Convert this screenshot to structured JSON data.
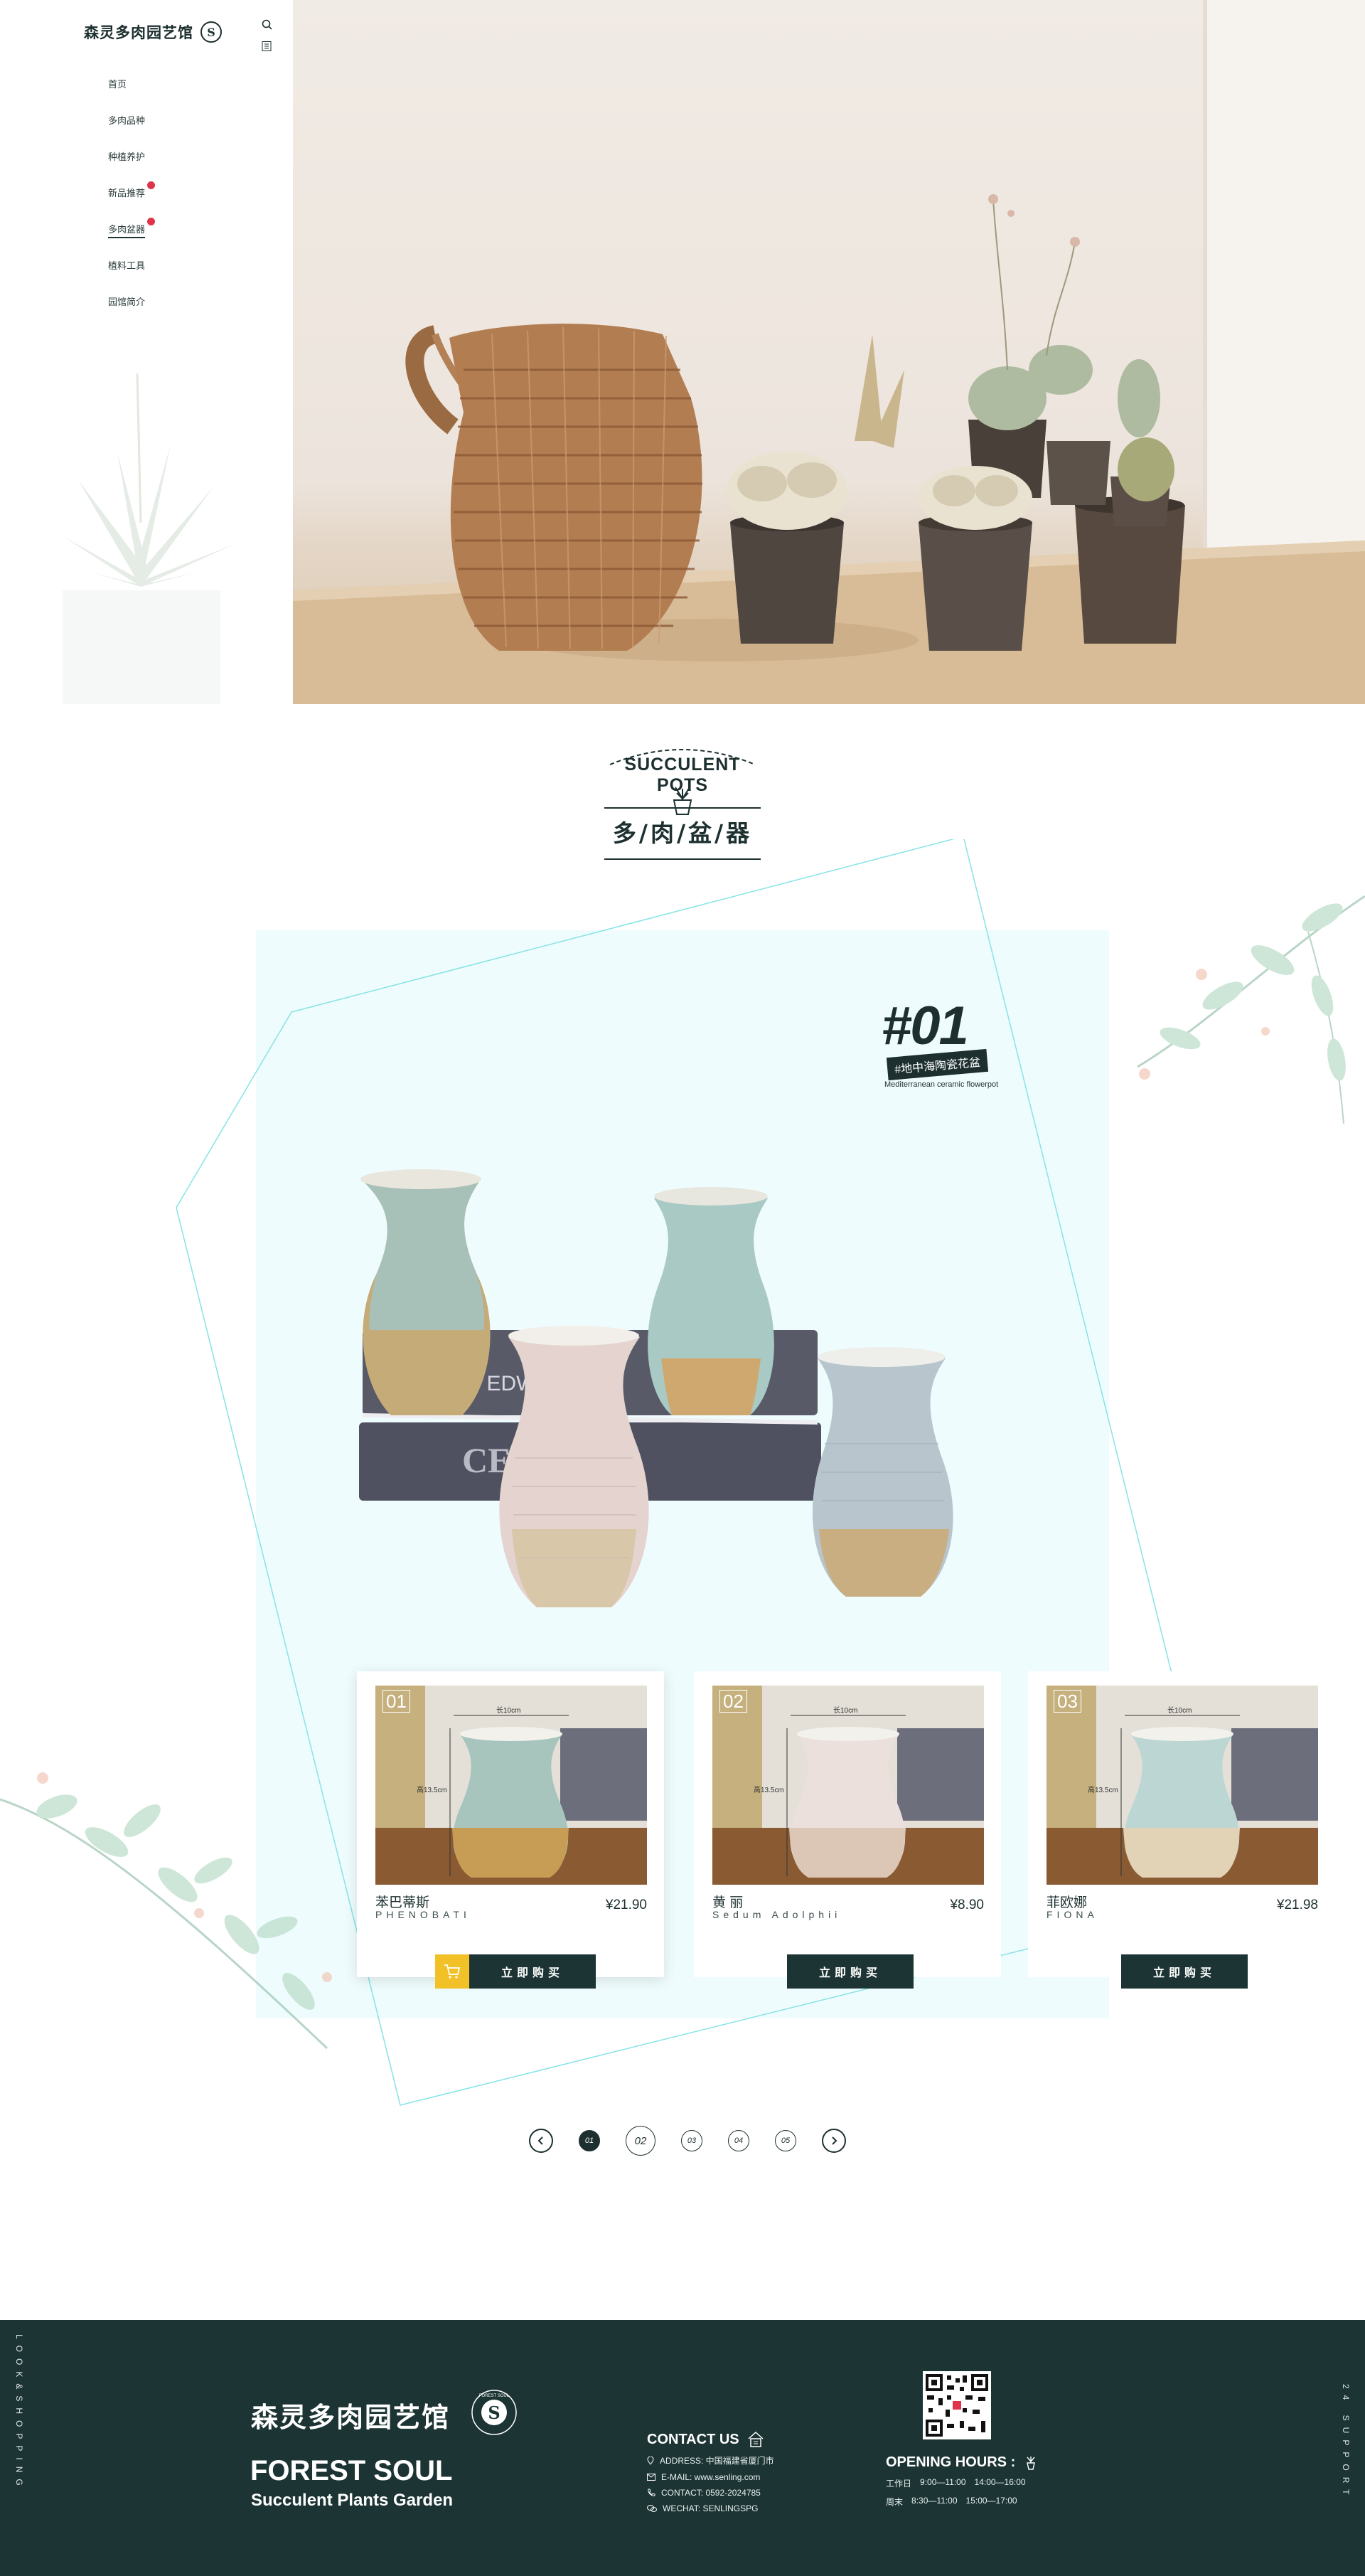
{
  "brand": {
    "name_cn": "森灵多肉园艺馆",
    "badge_letter": "S"
  },
  "nav": {
    "items": [
      {
        "label": "首页",
        "hot": false,
        "active": false
      },
      {
        "label": "多肉品种",
        "hot": false,
        "active": false
      },
      {
        "label": "种植养护",
        "hot": false,
        "active": false
      },
      {
        "label": "新品推荐",
        "hot": true,
        "active": false
      },
      {
        "label": "多肉盆器",
        "hot": true,
        "active": true
      },
      {
        "label": "植料工具",
        "hot": false,
        "active": false
      },
      {
        "label": "园馆简介",
        "hot": false,
        "active": false
      }
    ]
  },
  "section": {
    "title_en": "SUCCULENT POTS",
    "title_cn": "多/肉/盆/器"
  },
  "feature": {
    "number": "#01",
    "tag_cn": "#地中海陶瓷花盆",
    "tag_en": "Mediterranean ceramic flowerpot"
  },
  "products": [
    {
      "num": "01",
      "name": "苯巴蒂斯",
      "sub": "PHENOBATI",
      "price": "¥21.90",
      "buy_label": "立即购买",
      "dims_w": "长10cm",
      "dims_h": "高13.5cm",
      "glaze": "amber"
    },
    {
      "num": "02",
      "name": "黄 丽",
      "sub": "Sedum Adolphii",
      "price": "¥8.90",
      "buy_label": "立即购买",
      "dims_w": "长10cm",
      "dims_h": "高13.5cm",
      "glaze": "pink"
    },
    {
      "num": "03",
      "name": "菲欧娜",
      "sub": "FIONA",
      "price": "¥21.98",
      "buy_label": "立即购买",
      "dims_w": "长10cm",
      "dims_h": "高13.5cm",
      "glaze": "blue"
    }
  ],
  "pager": {
    "pages": [
      "01",
      "02",
      "03",
      "04",
      "05"
    ],
    "current": "01"
  },
  "footer": {
    "vertical_left": "LOOK&SHOPPING",
    "vertical_right": "24 SUPPORT",
    "brand_cn": "森灵多肉园艺馆",
    "seal_text": "FOREST SOUL",
    "brand_en": "FOREST SOUL",
    "brand_sub": "Succulent Plants Garden",
    "contact_title": "CONTACT US",
    "contact": {
      "address": "ADDRESS: 中国福建省厦门市",
      "email": "E-MAIL: www.senling.com",
      "phone": "CONTACT: 0592-2024785",
      "wechat": "WECHAT: SENLINGSPG"
    },
    "hours_title": "OPENING HOURS :",
    "hours": [
      {
        "label": "工作日",
        "am": "9:00—11:00",
        "pm": "14:00—16:00"
      },
      {
        "label": "周末",
        "am": "8:30—11:00",
        "pm": "15:00—17:00"
      }
    ]
  },
  "colors": {
    "dark": "#1c3434",
    "accent_yellow": "#f2c027",
    "hot_red": "#e0344a",
    "panel": "#effcfd",
    "frame": "#86e3e5"
  }
}
